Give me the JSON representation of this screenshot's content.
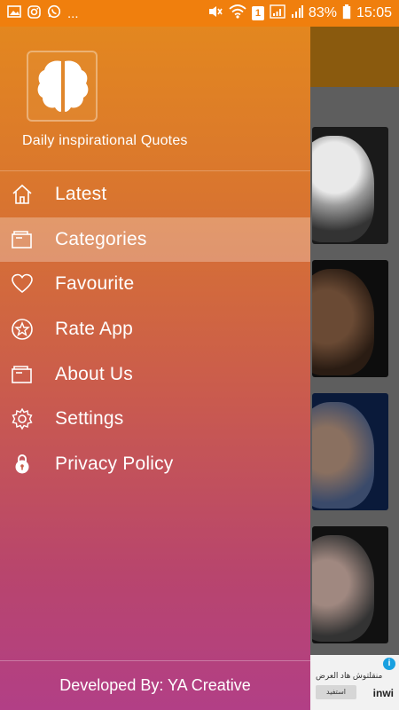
{
  "status_bar": {
    "left_icons": [
      "gallery-icon",
      "instagram-icon",
      "whatsapp-icon"
    ],
    "left_more": "...",
    "sim_badge": "1",
    "battery": "83%",
    "time": "15:05"
  },
  "drawer": {
    "app_title": "Daily inspirational Quotes",
    "menu": [
      {
        "label": "Latest",
        "icon": "home-icon"
      },
      {
        "label": "Categories",
        "icon": "folder-icon",
        "active": true
      },
      {
        "label": "Favourite",
        "icon": "heart-icon"
      },
      {
        "label": "Rate App",
        "icon": "star-icon"
      },
      {
        "label": "About Us",
        "icon": "folder-icon"
      },
      {
        "label": "Settings",
        "icon": "gear-icon"
      },
      {
        "label": "Privacy Policy",
        "icon": "lock-icon"
      }
    ],
    "footer": "Developed By: YA Creative"
  },
  "ad": {
    "text": "منقلتوش هاد العرض",
    "button": "استفيد",
    "brand": "inwi"
  },
  "colors": {
    "status_bar": "#f07f0d",
    "drawer_top": "#e3871f",
    "drawer_bottom": "#b23f86"
  }
}
